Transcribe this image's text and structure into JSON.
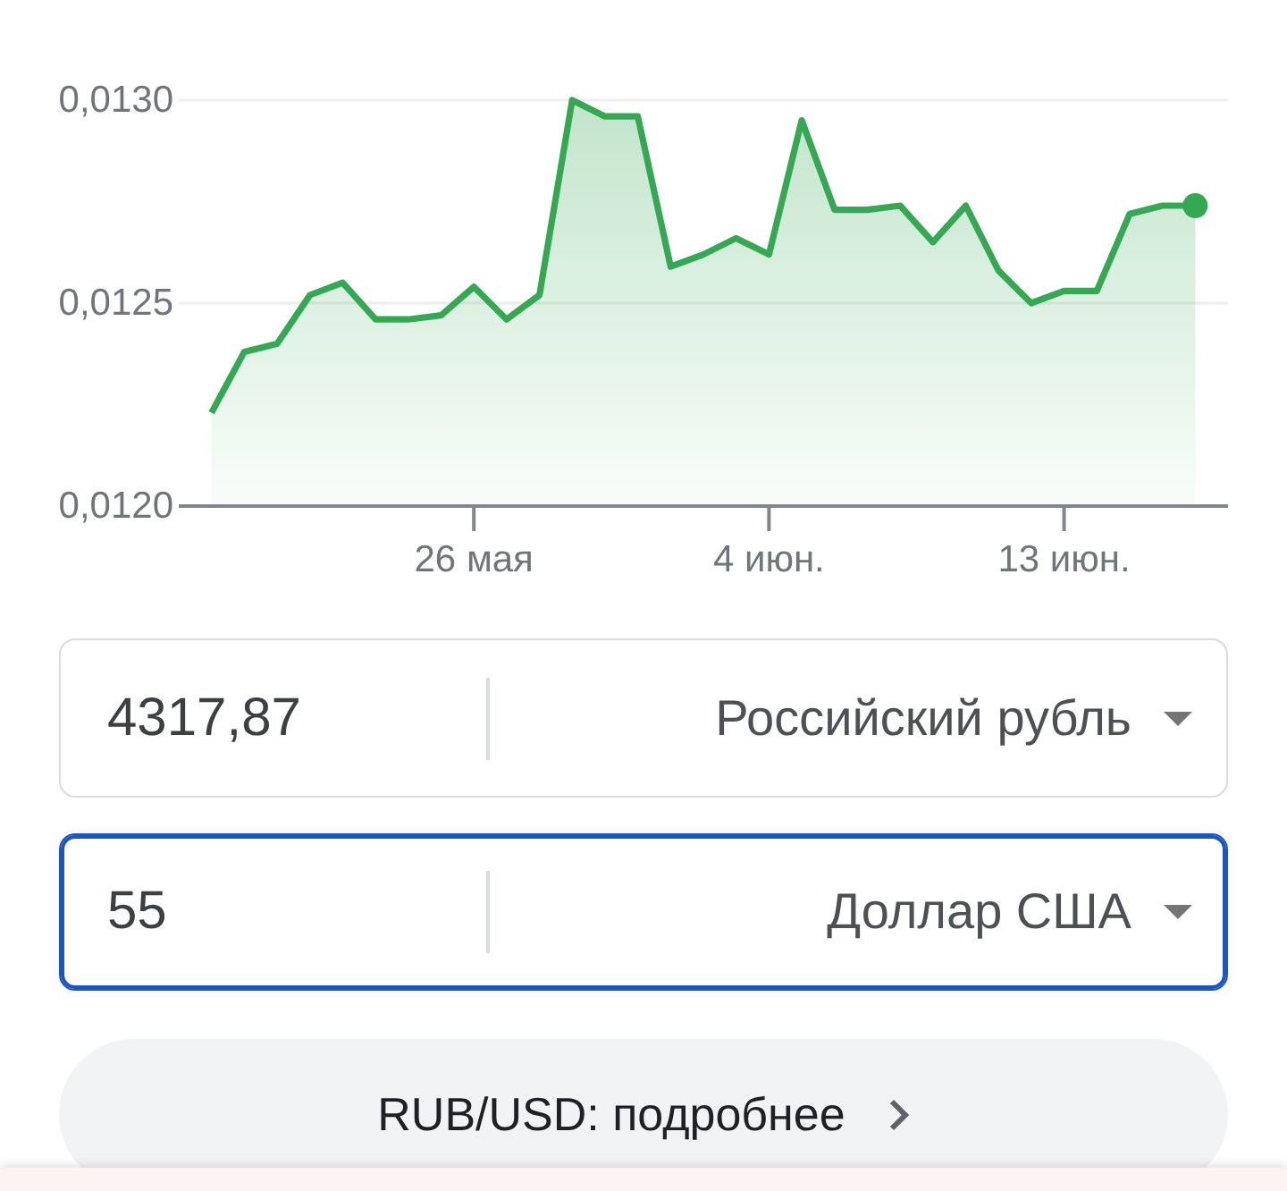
{
  "chart": {
    "chart_data": {
      "type": "area",
      "categories": [
        null,
        null,
        null,
        null,
        null,
        null,
        null,
        null,
        null,
        "26 мая",
        null,
        null,
        null,
        null,
        null,
        null,
        null,
        null,
        "4 июн.",
        null,
        null,
        null,
        null,
        null,
        null,
        null,
        null,
        "13 июн.",
        null,
        null,
        null,
        null,
        null
      ],
      "series": [
        {
          "color": "#34a853",
          "values": [
            null,
            0.01223,
            0.01238,
            0.0124,
            0.01252,
            0.01255,
            0.01246,
            0.01246,
            0.01247,
            0.01254,
            0.01246,
            0.01252,
            0.013,
            0.01296,
            0.01296,
            0.01259,
            0.01262,
            0.01266,
            0.01262,
            0.01295,
            0.01273,
            0.01273,
            0.01274,
            0.01265,
            0.01274,
            0.01258,
            0.0125,
            0.01253,
            0.01253,
            0.01272,
            0.01274,
            0.01274,
            null
          ]
        }
      ],
      "ylim": [
        0.012,
        0.013
      ],
      "yticks": [
        {
          "value": 0.012,
          "label": "0,0120"
        },
        {
          "value": 0.0125,
          "label": "0,0125"
        },
        {
          "value": 0.013,
          "label": "0,0130"
        }
      ]
    }
  },
  "converters": [
    {
      "amount": "4317,87",
      "currency": "Российский рубль",
      "focused": false
    },
    {
      "amount": "55",
      "currency": "Доллар США",
      "focused": true
    }
  ],
  "details_button": {
    "label": "RUB/USD: подробнее"
  }
}
